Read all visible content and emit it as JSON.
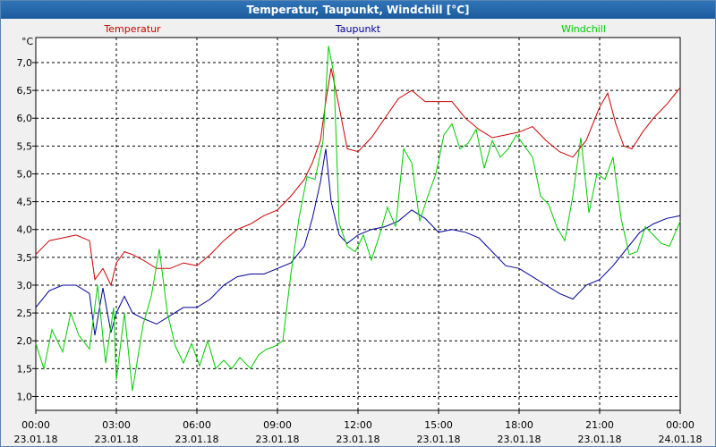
{
  "window": {
    "title": "Temperatur, Taupunkt, Windchill [°C]"
  },
  "chart_data": {
    "type": "line",
    "title": "Temperatur, Taupunkt, Windchill [°C]",
    "ylabel": "°C",
    "xlabel": "",
    "ylim": [
      0.75,
      7.45
    ],
    "xlim": [
      0,
      24
    ],
    "grid": true,
    "legend": "top",
    "yticks": [
      "1,0",
      "1,5",
      "2,0",
      "2,5",
      "3,0",
      "3,5",
      "4,0",
      "4,5",
      "5,0",
      "5,5",
      "6,0",
      "6,5",
      "7,0"
    ],
    "xticks": [
      {
        "time": "00:00",
        "date": "23.01.18"
      },
      {
        "time": "03:00",
        "date": "23.01.18"
      },
      {
        "time": "06:00",
        "date": "23.01.18"
      },
      {
        "time": "09:00",
        "date": "23.01.18"
      },
      {
        "time": "12:00",
        "date": "23.01.18"
      },
      {
        "time": "15:00",
        "date": "23.01.18"
      },
      {
        "time": "18:00",
        "date": "23.01.18"
      },
      {
        "time": "21:00",
        "date": "23.01.18"
      },
      {
        "time": "00:00",
        "date": "24.01.18"
      }
    ],
    "series": [
      {
        "name": "Temperatur",
        "color": "#cc0000",
        "x": [
          0,
          0.5,
          1,
          1.5,
          2,
          2.2,
          2.5,
          2.8,
          3.0,
          3.3,
          3.6,
          4,
          4.5,
          5,
          5.5,
          6,
          6.5,
          7,
          7.5,
          8,
          8.5,
          9,
          9.5,
          10,
          10.3,
          10.6,
          10.8,
          11,
          11.3,
          11.6,
          12,
          12.5,
          13,
          13.5,
          14,
          14.5,
          15,
          15.5,
          16,
          16.5,
          17,
          17.5,
          18,
          18.5,
          19,
          19.5,
          20,
          20.5,
          21,
          21.3,
          21.6,
          21.9,
          22.2,
          22.6,
          23,
          23.5,
          24
        ],
        "values": [
          3.55,
          3.8,
          3.85,
          3.9,
          3.8,
          3.1,
          3.3,
          3.0,
          3.4,
          3.6,
          3.55,
          3.45,
          3.3,
          3.3,
          3.4,
          3.35,
          3.55,
          3.8,
          4.0,
          4.1,
          4.25,
          4.35,
          4.6,
          4.9,
          5.2,
          5.6,
          6.3,
          6.9,
          6.2,
          5.45,
          5.4,
          5.65,
          6.0,
          6.35,
          6.5,
          6.3,
          6.3,
          6.3,
          6.0,
          5.8,
          5.65,
          5.7,
          5.75,
          5.85,
          5.6,
          5.4,
          5.3,
          5.6,
          6.2,
          6.45,
          5.9,
          5.5,
          5.45,
          5.75,
          6.0,
          6.25,
          6.55
        ]
      },
      {
        "name": "Taupunkt",
        "color": "#000099",
        "x": [
          0,
          0.5,
          1,
          1.5,
          2,
          2.2,
          2.5,
          2.8,
          3.0,
          3.3,
          3.6,
          4,
          4.5,
          5,
          5.5,
          6,
          6.5,
          7,
          7.5,
          8,
          8.5,
          9,
          9.5,
          10,
          10.3,
          10.6,
          10.8,
          11,
          11.3,
          11.6,
          12,
          12.5,
          13,
          13.5,
          14,
          14.5,
          15,
          15.5,
          16,
          16.5,
          17,
          17.5,
          18,
          18.5,
          19,
          19.5,
          20,
          20.5,
          21,
          21.5,
          22,
          22.5,
          23,
          23.5,
          24
        ],
        "values": [
          2.6,
          2.9,
          3.0,
          3.0,
          2.85,
          2.1,
          2.95,
          2.15,
          2.5,
          2.8,
          2.5,
          2.4,
          2.3,
          2.45,
          2.6,
          2.6,
          2.75,
          3.0,
          3.15,
          3.2,
          3.2,
          3.3,
          3.4,
          3.7,
          4.2,
          4.85,
          5.45,
          4.5,
          3.9,
          3.75,
          3.9,
          4.0,
          4.05,
          4.15,
          4.35,
          4.2,
          3.95,
          4.0,
          3.95,
          3.85,
          3.6,
          3.35,
          3.3,
          3.15,
          3.0,
          2.85,
          2.75,
          3.0,
          3.1,
          3.35,
          3.65,
          3.95,
          4.1,
          4.2,
          4.25
        ]
      },
      {
        "name": "Windchill",
        "color": "#00cc00",
        "x": [
          0,
          0.3,
          0.6,
          1.0,
          1.3,
          1.6,
          2.0,
          2.3,
          2.6,
          2.9,
          3.0,
          3.3,
          3.6,
          4.0,
          4.3,
          4.6,
          4.9,
          5.2,
          5.5,
          5.8,
          6.1,
          6.4,
          6.7,
          7.0,
          7.3,
          7.6,
          8.0,
          8.3,
          8.6,
          8.9,
          9.2,
          9.5,
          9.8,
          10.1,
          10.4,
          10.7,
          10.9,
          11.1,
          11.3,
          11.6,
          11.9,
          12.2,
          12.5,
          12.8,
          13.1,
          13.4,
          13.7,
          14.0,
          14.3,
          14.6,
          14.9,
          15.2,
          15.5,
          15.8,
          16.1,
          16.4,
          16.7,
          17.0,
          17.3,
          17.6,
          17.9,
          18.2,
          18.5,
          18.8,
          19.1,
          19.4,
          19.7,
          20.0,
          20.3,
          20.6,
          20.9,
          21.2,
          21.5,
          21.8,
          22.1,
          22.4,
          22.7,
          23.0,
          23.3,
          23.6,
          24.0
        ],
        "values": [
          1.95,
          1.5,
          2.2,
          1.8,
          2.5,
          2.1,
          1.85,
          3.0,
          1.6,
          2.6,
          1.3,
          2.5,
          1.1,
          2.3,
          2.8,
          3.65,
          2.5,
          1.9,
          1.6,
          1.95,
          1.55,
          2.0,
          1.5,
          1.65,
          1.5,
          1.7,
          1.5,
          1.75,
          1.85,
          1.9,
          2.0,
          3.2,
          4.2,
          4.95,
          4.9,
          5.6,
          7.3,
          6.8,
          4.1,
          3.7,
          3.6,
          3.9,
          3.45,
          3.9,
          4.4,
          4.05,
          5.45,
          5.2,
          4.15,
          4.6,
          5.0,
          5.7,
          5.9,
          5.45,
          5.55,
          5.8,
          5.1,
          5.6,
          5.3,
          5.45,
          5.7,
          5.5,
          5.3,
          4.6,
          4.45,
          4.05,
          3.8,
          4.6,
          5.65,
          4.3,
          5.0,
          4.9,
          5.3,
          4.2,
          3.55,
          3.6,
          4.05,
          3.9,
          3.75,
          3.7,
          4.15
        ]
      }
    ]
  }
}
